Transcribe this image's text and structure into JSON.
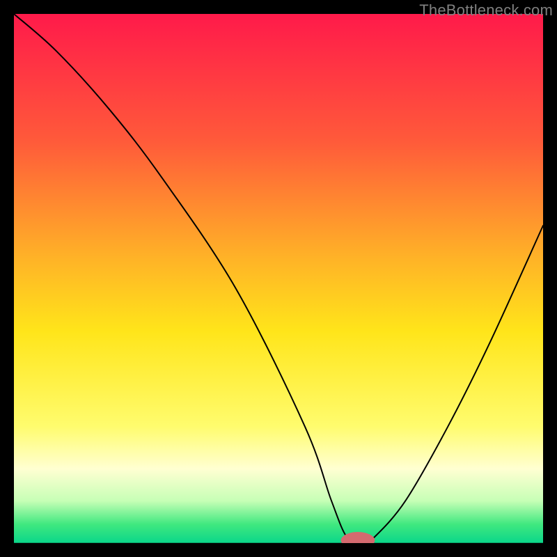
{
  "watermark": "TheBottleneck.com",
  "chart_data": {
    "type": "line",
    "title": "",
    "xlabel": "",
    "ylabel": "",
    "xlim": [
      0,
      100
    ],
    "ylim": [
      0,
      100
    ],
    "background_gradient_stops": [
      {
        "offset": 0,
        "color": "#ff1a4a"
      },
      {
        "offset": 0.24,
        "color": "#ff5a3a"
      },
      {
        "offset": 0.46,
        "color": "#ffb227"
      },
      {
        "offset": 0.6,
        "color": "#ffe51a"
      },
      {
        "offset": 0.78,
        "color": "#fffc6e"
      },
      {
        "offset": 0.86,
        "color": "#ffffd2"
      },
      {
        "offset": 0.92,
        "color": "#c7ffb6"
      },
      {
        "offset": 0.965,
        "color": "#3fe87f"
      },
      {
        "offset": 1.0,
        "color": "#0ad68a"
      }
    ],
    "line_color": "#000000",
    "series": [
      {
        "name": "bottleneck-curve",
        "x": [
          0,
          8,
          18,
          28,
          42,
          55,
          60,
          63,
          66,
          68,
          74,
          82,
          90,
          100
        ],
        "values": [
          100,
          93,
          82,
          69,
          48,
          22,
          8,
          1,
          0,
          1,
          8,
          22,
          38,
          60
        ]
      }
    ],
    "marker": {
      "name": "optimal-point",
      "x": 65,
      "y": 0.5,
      "rx": 3.2,
      "ry": 1.6,
      "color": "#d46a6f"
    },
    "baseline": {
      "y": 0,
      "color": "#000000"
    }
  }
}
